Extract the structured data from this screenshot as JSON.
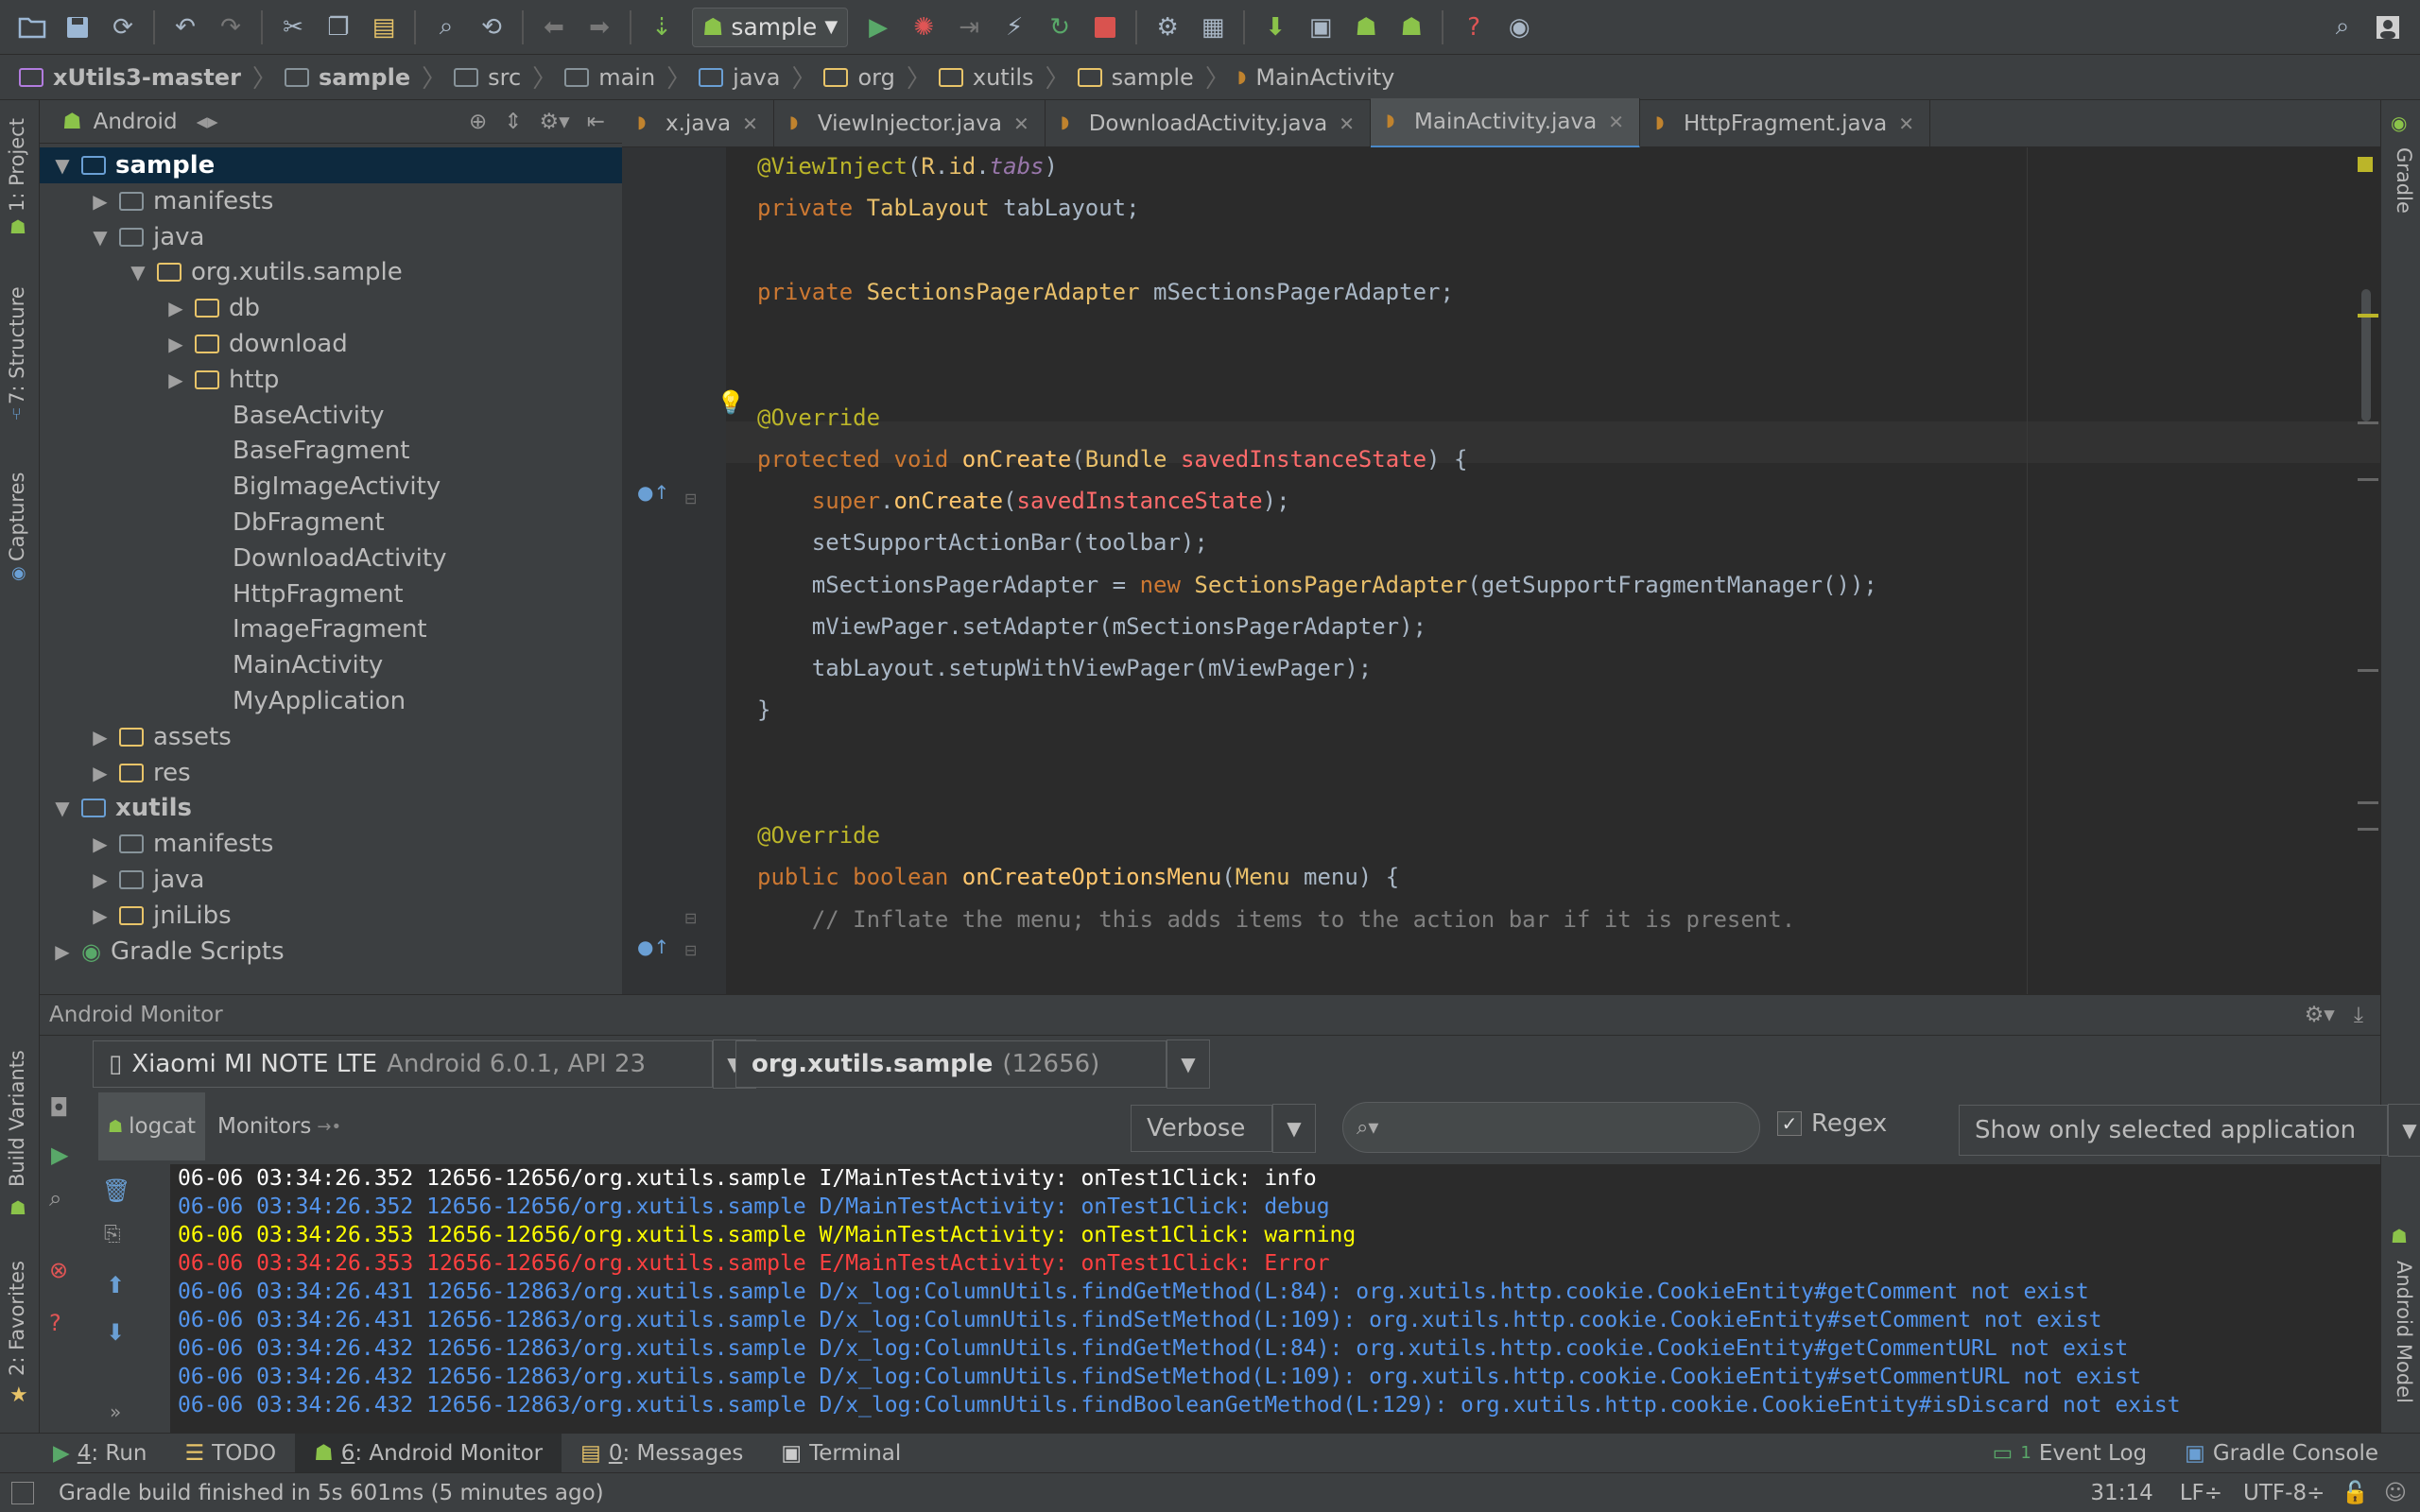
{
  "toolbar": {
    "run_config": "sample",
    "icons": [
      "open-folder-icon",
      "save-icon",
      "sync-icon",
      "undo-icon",
      "redo-icon",
      "cut-icon",
      "copy-icon",
      "paste-icon",
      "find-icon",
      "replace-icon",
      "back-icon",
      "forward-icon",
      "make-icon",
      "android-icon",
      "run-icon",
      "debug-icon",
      "attach-icon",
      "apply-changes-icon",
      "rerun-icon",
      "stop-icon",
      "settings-icon",
      "project-structure-icon",
      "avd-icon",
      "sdk-icon",
      "device-monitor-icon",
      "android-sdk-icon",
      "help-icon",
      "monitor-icon",
      "search-everywhere-icon",
      "user-icon"
    ]
  },
  "breadcrumb": {
    "items": [
      "xUtils3-master",
      "sample",
      "src",
      "main",
      "java",
      "org",
      "xutils",
      "sample",
      "MainActivity"
    ]
  },
  "left_strip": {
    "tabs": [
      "1: Project",
      "7: Structure",
      "Captures",
      "Build Variants",
      "2: Favorites"
    ]
  },
  "right_strip": {
    "tabs": [
      "Gradle",
      "Android Model"
    ]
  },
  "project": {
    "view": "Android",
    "tree": [
      {
        "label": "sample",
        "depth": 0,
        "expanded": true,
        "icon": "module",
        "bold": true
      },
      {
        "label": "manifests",
        "depth": 1,
        "expanded": false,
        "icon": "folder"
      },
      {
        "label": "java",
        "depth": 1,
        "expanded": true,
        "icon": "folder"
      },
      {
        "label": "org.xutils.sample",
        "depth": 2,
        "expanded": true,
        "icon": "package"
      },
      {
        "label": "db",
        "depth": 3,
        "expanded": false,
        "icon": "package"
      },
      {
        "label": "download",
        "depth": 3,
        "expanded": false,
        "icon": "package"
      },
      {
        "label": "http",
        "depth": 3,
        "expanded": false,
        "icon": "package"
      },
      {
        "label": "BaseActivity",
        "depth": 4,
        "icon": "class"
      },
      {
        "label": "BaseFragment",
        "depth": 4,
        "icon": "class"
      },
      {
        "label": "BigImageActivity",
        "depth": 4,
        "icon": "class"
      },
      {
        "label": "DbFragment",
        "depth": 4,
        "icon": "class"
      },
      {
        "label": "DownloadActivity",
        "depth": 4,
        "icon": "class"
      },
      {
        "label": "HttpFragment",
        "depth": 4,
        "icon": "class"
      },
      {
        "label": "ImageFragment",
        "depth": 4,
        "icon": "class"
      },
      {
        "label": "MainActivity",
        "depth": 4,
        "icon": "class"
      },
      {
        "label": "MyApplication",
        "depth": 4,
        "icon": "class"
      },
      {
        "label": "assets",
        "depth": 1,
        "expanded": false,
        "icon": "res-folder"
      },
      {
        "label": "res",
        "depth": 1,
        "expanded": false,
        "icon": "res-folder"
      },
      {
        "label": "xutils",
        "depth": 0,
        "expanded": true,
        "icon": "module",
        "bold": true
      },
      {
        "label": "manifests",
        "depth": 1,
        "expanded": false,
        "icon": "folder"
      },
      {
        "label": "java",
        "depth": 1,
        "expanded": false,
        "icon": "folder"
      },
      {
        "label": "jniLibs",
        "depth": 1,
        "expanded": false,
        "icon": "res-folder"
      },
      {
        "label": "Gradle Scripts",
        "depth": 0,
        "expanded": false,
        "icon": "gradle"
      }
    ]
  },
  "editor": {
    "tabs": [
      {
        "label": "x.java",
        "active": false
      },
      {
        "label": "ViewInjector.java",
        "active": false
      },
      {
        "label": "DownloadActivity.java",
        "active": false
      },
      {
        "label": "MainActivity.java",
        "active": true
      },
      {
        "label": "HttpFragment.java",
        "active": false
      }
    ],
    "lines": [
      [
        [
          "ann",
          "@ViewInject"
        ],
        [
          "",
          "("
        ],
        [
          "typ",
          "R"
        ],
        [
          "",
          "."
        ],
        [
          "typ",
          "id"
        ],
        [
          "",
          "."
        ],
        [
          "fld",
          "tabs"
        ],
        [
          "",
          ")"
        ]
      ],
      [
        [
          "kw",
          "private "
        ],
        [
          "typ",
          "TabLayout"
        ],
        [
          "",
          " tabLayout;"
        ]
      ],
      [],
      [
        [
          "kw",
          "private "
        ],
        [
          "typ",
          "SectionsPagerAdapter"
        ],
        [
          "",
          " mSectionsPagerAdapter;"
        ]
      ],
      [],
      [],
      [
        [
          "ann",
          "@Override"
        ]
      ],
      [
        [
          "kw",
          "protected void "
        ],
        [
          "fn",
          "onCreate"
        ],
        [
          "",
          "("
        ],
        [
          "typ",
          "Bundle"
        ],
        [
          "",
          " "
        ],
        [
          "prm",
          "savedInstanceState"
        ],
        [
          "",
          ") {"
        ]
      ],
      [
        [
          "",
          "    "
        ],
        [
          "kw",
          "super"
        ],
        [
          "",
          "."
        ],
        [
          "fn",
          "onCreate"
        ],
        [
          "",
          "("
        ],
        [
          "prm",
          "savedInstanceState"
        ],
        [
          "",
          ");"
        ]
      ],
      [
        [
          "",
          "    setSupportActionBar(toolbar);"
        ]
      ],
      [
        [
          "",
          "    mSectionsPagerAdapter = "
        ],
        [
          "kw",
          "new "
        ],
        [
          "typ",
          "SectionsPagerAdapter"
        ],
        [
          "",
          "(getSupportFragmentManager());"
        ]
      ],
      [
        [
          "",
          "    mViewPager.setAdapter(mSectionsPagerAdapter);"
        ]
      ],
      [
        [
          "",
          "    tabLayout.setupWithViewPager(mViewPager);"
        ]
      ],
      [
        [
          "",
          "}"
        ]
      ],
      [],
      [],
      [
        [
          "ann",
          "@Override"
        ]
      ],
      [
        [
          "kw",
          "public boolean "
        ],
        [
          "fn",
          "onCreateOptionsMenu"
        ],
        [
          "",
          "("
        ],
        [
          "typ",
          "Menu"
        ],
        [
          "",
          " menu) {"
        ]
      ],
      [
        [
          "cmt",
          "    // Inflate the menu; this adds items to the action bar if it is present."
        ]
      ]
    ]
  },
  "monitor": {
    "title": "Android Monitor",
    "device_name": "Xiaomi MI NOTE LTE",
    "device_api": "Android 6.0.1, API 23",
    "process_name": "org.xutils.sample",
    "process_pid": "(12656)",
    "tabs": [
      "logcat",
      "Monitors"
    ],
    "log_level": "Verbose",
    "search_placeholder": "",
    "regex_label": "Regex",
    "regex_checked": true,
    "filter": "Show only selected application",
    "log_lines": [
      {
        "level": "info",
        "text": "06-06 03:34:26.352 12656-12656/org.xutils.sample I/MainTestActivity: onTest1Click: info"
      },
      {
        "level": "debug",
        "text": "06-06 03:34:26.352 12656-12656/org.xutils.sample D/MainTestActivity: onTest1Click: debug"
      },
      {
        "level": "warn",
        "text": "06-06 03:34:26.353 12656-12656/org.xutils.sample W/MainTestActivity: onTest1Click: warning"
      },
      {
        "level": "err",
        "text": "06-06 03:34:26.353 12656-12656/org.xutils.sample E/MainTestActivity: onTest1Click: Error"
      },
      {
        "level": "debug",
        "text": "06-06 03:34:26.431 12656-12863/org.xutils.sample D/x_log:ColumnUtils.findGetMethod(L:84): org.xutils.http.cookie.CookieEntity#getComment not exist"
      },
      {
        "level": "debug",
        "text": "06-06 03:34:26.431 12656-12863/org.xutils.sample D/x_log:ColumnUtils.findSetMethod(L:109): org.xutils.http.cookie.CookieEntity#setComment not exist"
      },
      {
        "level": "debug",
        "text": "06-06 03:34:26.432 12656-12863/org.xutils.sample D/x_log:ColumnUtils.findGetMethod(L:84): org.xutils.http.cookie.CookieEntity#getCommentURL not exist"
      },
      {
        "level": "debug",
        "text": "06-06 03:34:26.432 12656-12863/org.xutils.sample D/x_log:ColumnUtils.findSetMethod(L:109): org.xutils.http.cookie.CookieEntity#setCommentURL not exist"
      },
      {
        "level": "debug",
        "text": "06-06 03:34:26.432 12656-12863/org.xutils.sample D/x_log:ColumnUtils.findBooleanGetMethod(L:129): org.xutils.http.cookie.CookieEntity#isDiscard not exist"
      }
    ]
  },
  "tool_windows": {
    "left": [
      {
        "num": "4",
        "label": ": Run",
        "icon": "run-icon",
        "active": false
      },
      {
        "num": "",
        "label": "TODO",
        "icon": "todo-icon",
        "active": false
      },
      {
        "num": "6",
        "label": ": Android Monitor",
        "icon": "android-icon",
        "active": true
      },
      {
        "num": "0",
        "label": ": Messages",
        "icon": "messages-icon",
        "active": false
      },
      {
        "num": "",
        "label": "Terminal",
        "icon": "terminal-icon",
        "active": false
      }
    ],
    "right": [
      {
        "label": "Event Log",
        "icon": "event-log-icon",
        "badge": "1"
      },
      {
        "label": "Gradle Console",
        "icon": "gradle-console-icon"
      }
    ]
  },
  "status": {
    "message": "Gradle build finished in 5s 601ms (5 minutes ago)",
    "position": "31:14",
    "line_sep": "LF÷",
    "encoding": "UTF-8÷"
  },
  "colors": {
    "accent": "#4a88c7",
    "selection": "#0d293e",
    "error": "#ff4040",
    "warning": "#ffff00",
    "debug": "#5394ec"
  }
}
